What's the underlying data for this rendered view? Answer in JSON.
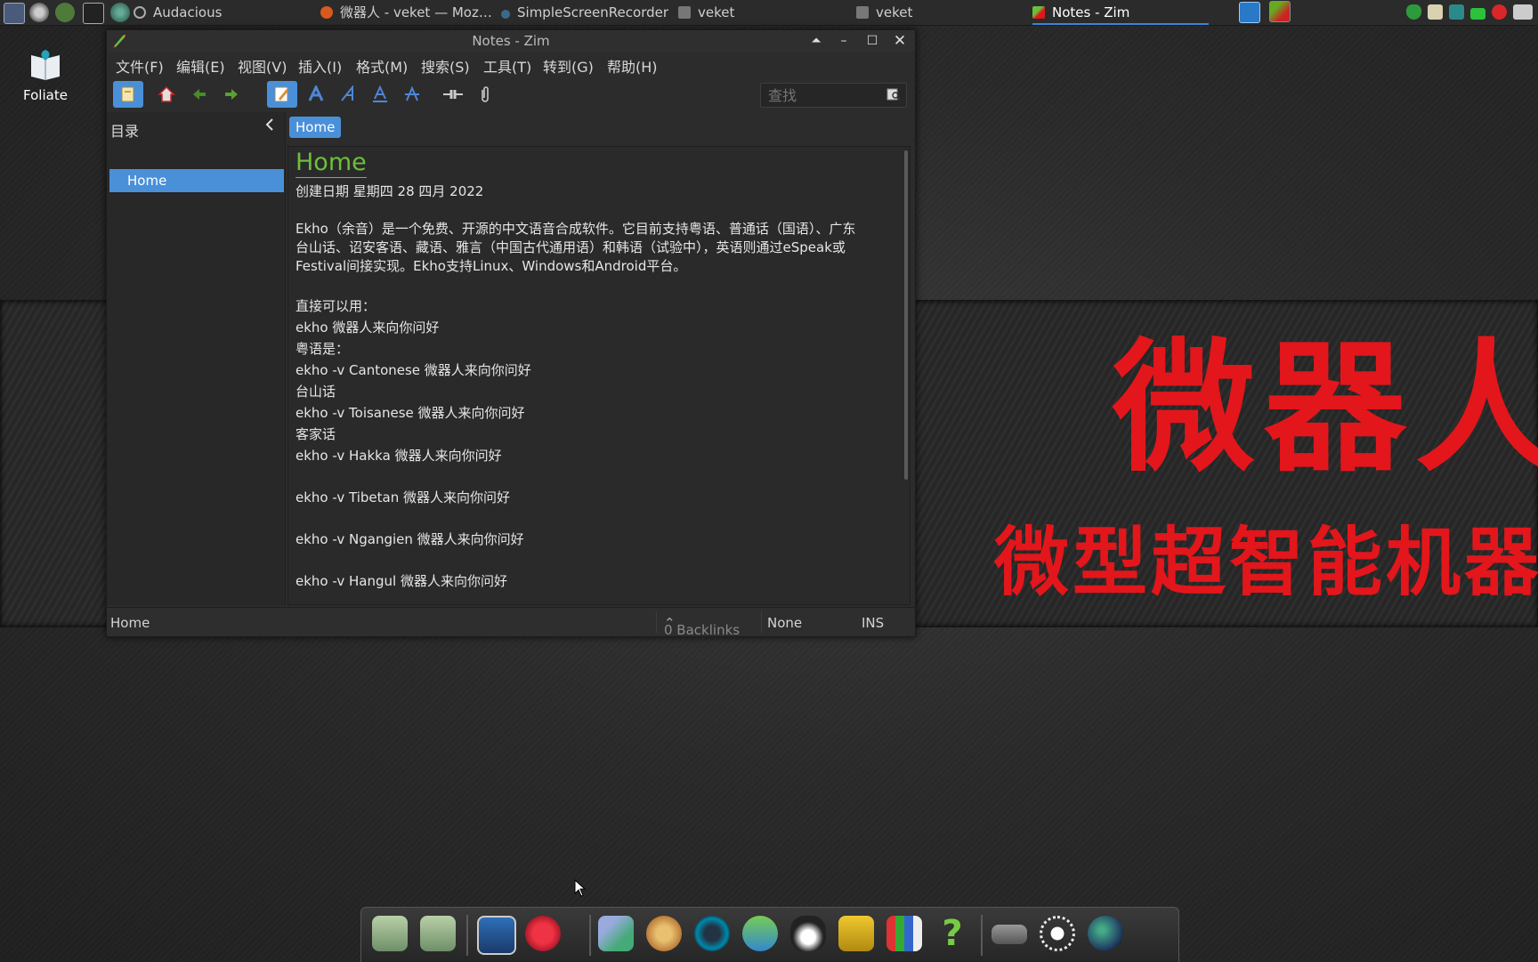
{
  "taskbar": {
    "items": [
      {
        "label": "Audacious"
      },
      {
        "label": "微器人 - veket — Moz…"
      },
      {
        "label": "SimpleScreenRecorder"
      },
      {
        "label": "veket"
      },
      {
        "label": "veket"
      },
      {
        "label": "Notes - Zim",
        "active": true
      }
    ]
  },
  "desktop": {
    "icon_label": "Foliate",
    "banner_big": "微器人",
    "banner_small": "微型超智能机器"
  },
  "window": {
    "title": "Notes - Zim",
    "menu": [
      "文件(F)",
      "编辑(E)",
      "视图(V)",
      "插入(I)",
      "格式(M)",
      "搜索(S)",
      "工具(T)",
      "转到(G)",
      "帮助(H)"
    ],
    "search_placeholder": "查找",
    "index_title": "目录",
    "index_items": [
      "Home"
    ],
    "pathbar": [
      "Home"
    ],
    "page": {
      "heading": "Home",
      "created": "创建日期 星期四 28 四月 2022",
      "paragraph": [
        "Ekho（余音）是一个免费、开源的中文语音合成软件。它目前支持粤语、普通话（国语）、广东",
        "台山话、诏安客语、藏语、雅言（中国古代通用语）和韩语（试验中），英语则通过eSpeak或",
        "Festival间接实现。Ekho支持Linux、Windows和Android平台。"
      ],
      "lines": [
        "直接可以用：",
        "ekho 微器人来向你问好",
        "粤语是：",
        "ekho -v Cantonese 微器人来向你问好",
        "台山话",
        "ekho -v Toisanese 微器人来向你问好",
        "客家话",
        "ekho -v Hakka 微器人来向你问好",
        "ekho -v Tibetan 微器人来向你问好",
        "ekho -v Ngangien 微器人来向你问好",
        "ekho -v Hangul 微器人来向你问好"
      ]
    },
    "status": {
      "page": "Home",
      "backlinks": "0 Backlinks",
      "style": "None",
      "mode": "INS"
    }
  },
  "colors": {
    "accent": "#4a90d9",
    "heading": "#6cbf3a",
    "banner_red": "#e3161b"
  }
}
